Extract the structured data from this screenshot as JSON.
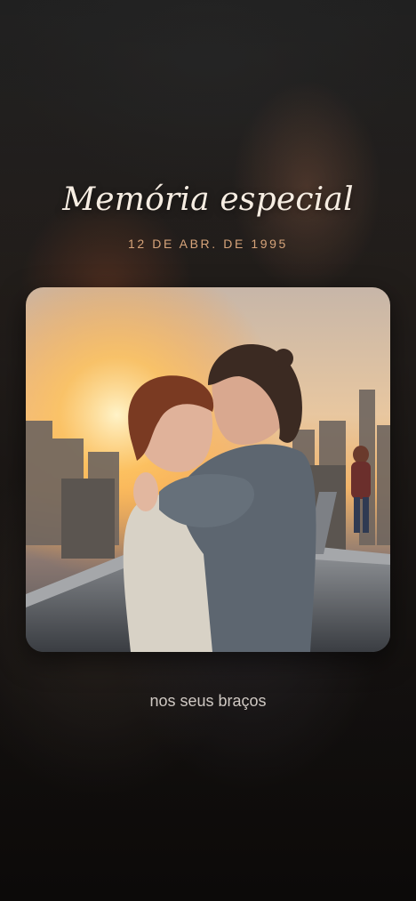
{
  "memory": {
    "title": "Memória especial",
    "date": "12 DE ABR. DE 1995",
    "caption": "nos seus braços",
    "photo": {
      "subject": "sunset-rooftop-hug-photo"
    }
  },
  "colors": {
    "title": "#f6ede2",
    "date": "#d7a47a",
    "caption": "#cfc8c2",
    "background": "#1f1b19"
  }
}
